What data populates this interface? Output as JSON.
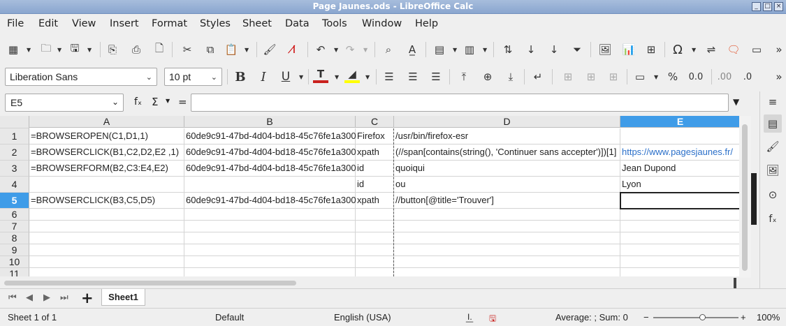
{
  "window": {
    "title": "Page Jaunes.ods - LibreOffice Calc"
  },
  "menu": [
    "File",
    "Edit",
    "View",
    "Insert",
    "Format",
    "Styles",
    "Sheet",
    "Data",
    "Tools",
    "Window",
    "Help"
  ],
  "font": {
    "name": "Liberation Sans",
    "size": "10 pt"
  },
  "formula_bar": {
    "cell_ref": "E5",
    "content": "",
    "fx": "fₓ",
    "sum": "Σ",
    "equals": "="
  },
  "columns": [
    "A",
    "B",
    "C",
    "D",
    "E"
  ],
  "selected_column": "E",
  "rows": [
    "1",
    "2",
    "3",
    "4",
    "5",
    "6",
    "7",
    "8",
    "9",
    "10",
    "11"
  ],
  "selected_row": "5",
  "cells": {
    "r1": [
      "=BROWSEROPEN(C1,D1,1)",
      "60de9c91-47bd-4d04-bd18-45c76fe1a300",
      "Firefox",
      "/usr/bin/firefox-esr",
      ""
    ],
    "r2": [
      "=BROWSERCLICK(B1,C2,D2,E2 ,1)",
      "60de9c91-47bd-4d04-bd18-45c76fe1a300",
      "xpath",
      "(//span[contains(string(), 'Continuer sans accepter')])[1]",
      "https://www.pagesjaunes.fr/"
    ],
    "r3": [
      "=BROWSERFORM(B2,C3:E4,E2)",
      "60de9c91-47bd-4d04-bd18-45c76fe1a300",
      "id",
      "quoiqui",
      "Jean Dupond"
    ],
    "r4": [
      "",
      "",
      "id",
      "ou",
      "Lyon"
    ],
    "r5": [
      "=BROWSERCLICK(B3,C5,D5)",
      "60de9c91-47bd-4d04-bd18-45c76fe1a300",
      "xpath",
      "//button[@title='Trouver']",
      ""
    ]
  },
  "sheet_tabs": [
    "Sheet1"
  ],
  "status": {
    "sheet": "Sheet 1 of 1",
    "style": "Default",
    "language": "English (USA)",
    "summary": "Average: ; Sum: 0",
    "zoom": "100%",
    "zoom_minus": "−",
    "zoom_plus": "+"
  },
  "colors": {
    "accent": "#3f9ce8",
    "link": "#2a6fc9",
    "titlebar": "#8aa6cf"
  }
}
